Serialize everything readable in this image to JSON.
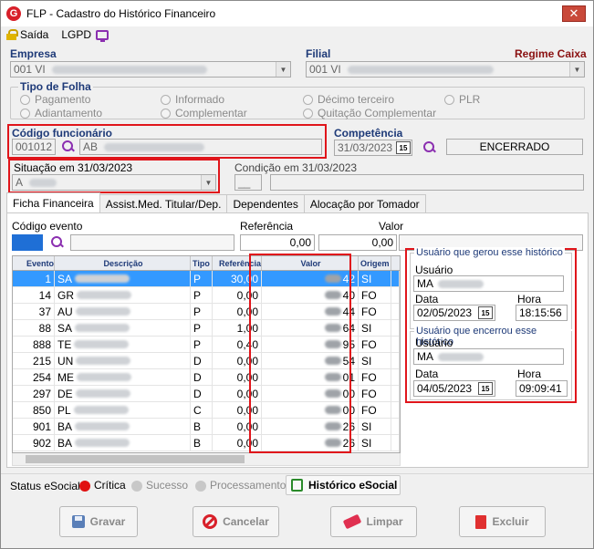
{
  "window": {
    "title": "FLP - Cadastro do Histórico Financeiro",
    "logo": "G"
  },
  "menu": {
    "exit": "Saída",
    "lgpd": "LGPD"
  },
  "company": {
    "label": "Empresa",
    "value": "001 VI",
    "branch_label": "Filial",
    "branch_value": "001 VI",
    "regime": "Regime Caixa"
  },
  "payroll_type": {
    "label": "Tipo de Folha",
    "options": [
      "Pagamento",
      "Adiantamento",
      "Informado",
      "Complementar",
      "Décimo terceiro",
      "Quitação Complementar",
      "PLR"
    ]
  },
  "employee": {
    "label": "Código funcionário",
    "code": "001012",
    "name": "AB"
  },
  "competence": {
    "label": "Competência",
    "date": "31/03/2023",
    "status": "ENCERRADO"
  },
  "situation": {
    "label": "Situação em  31/03/2023",
    "value": "A"
  },
  "condition": {
    "label": "Condição em 31/03/2023",
    "value": "__"
  },
  "tabs": [
    "Ficha Financeira",
    "Assist.Med. Titular/Dep.",
    "Dependentes",
    "Alocação por Tomador"
  ],
  "event_form": {
    "event_label": "Código evento",
    "ref_label": "Referência",
    "ref_value": "0,00",
    "val_label": "Valor",
    "val_value": "0,00"
  },
  "grid": {
    "headers": [
      "Evento",
      "Descrição",
      "Tipo",
      "Referência",
      "Valor",
      "Origem"
    ],
    "rows": [
      {
        "ev": "1",
        "desc": "SA",
        "tipo": "P",
        "ref": "30,00",
        "val": "42",
        "orig": "SI"
      },
      {
        "ev": "14",
        "desc": "GR",
        "tipo": "P",
        "ref": "0,00",
        "val": "40",
        "orig": "FO"
      },
      {
        "ev": "37",
        "desc": "AU",
        "tipo": "P",
        "ref": "0,00",
        "val": "44",
        "orig": "FO"
      },
      {
        "ev": "88",
        "desc": "SA",
        "tipo": "P",
        "ref": "1,00",
        "val": "64",
        "orig": "SI"
      },
      {
        "ev": "888",
        "desc": "TE",
        "tipo": "P",
        "ref": "0,40",
        "val": "95",
        "orig": "FO"
      },
      {
        "ev": "215",
        "desc": "UN",
        "tipo": "D",
        "ref": "0,00",
        "val": "54",
        "orig": "SI"
      },
      {
        "ev": "254",
        "desc": "ME",
        "tipo": "D",
        "ref": "0,00",
        "val": "01",
        "orig": "FO"
      },
      {
        "ev": "297",
        "desc": "DE",
        "tipo": "D",
        "ref": "0,00",
        "val": "00",
        "orig": "FO"
      },
      {
        "ev": "850",
        "desc": "PL",
        "tipo": "C",
        "ref": "0,00",
        "val": "00",
        "orig": "FO"
      },
      {
        "ev": "901",
        "desc": "BA",
        "tipo": "B",
        "ref": "0,00",
        "val": "26",
        "orig": "SI"
      },
      {
        "ev": "902",
        "desc": "BA",
        "tipo": "B",
        "ref": "0,00",
        "val": "26",
        "orig": "SI"
      }
    ]
  },
  "created_by": {
    "title": "Usuário que gerou esse histórico",
    "user_label": "Usuário",
    "user": "MA",
    "date_label": "Data",
    "date": "02/05/2023",
    "time_label": "Hora",
    "time": "18:15:56"
  },
  "closed_by": {
    "title": "Usuário que encerrou esse histórico",
    "user_label": "Usuário",
    "user": "MA",
    "date_label": "Data",
    "date": "04/05/2023",
    "time_label": "Hora",
    "time": "09:09:41"
  },
  "esocial": {
    "label": "Status eSocial:",
    "critical": "Crítica",
    "success": "Sucesso",
    "processing": "Processamento",
    "history_btn": "Histórico eSocial",
    "critical_color": "#e01010"
  },
  "buttons": {
    "save": "Gravar",
    "cancel": "Cancelar",
    "clear": "Limpar",
    "delete": "Excluir"
  },
  "cal_glyph": "15"
}
